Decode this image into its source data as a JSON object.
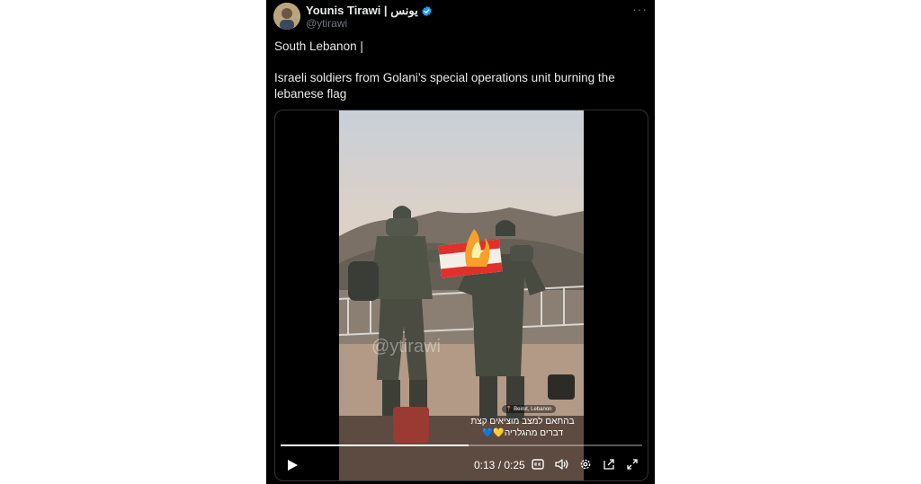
{
  "author": {
    "name": "Younis Tirawi | يونس",
    "handle": "@ytirawi",
    "more_label": "···"
  },
  "post": {
    "line1": "South Lebanon |",
    "line2": "Israeli soldiers from Golani’s special operations unit burning the lebanese flag"
  },
  "video": {
    "watermark": "@ytirawi",
    "location_tag": "Beirut, Lebanon",
    "caption_line1": "בהתאם למצב מוציאים קצת",
    "caption_line2": "דברים מהגלריה💛💙",
    "time": "0:13 / 0:25",
    "progress": 0.52,
    "icons": [
      "play-icon",
      "captions-icon",
      "volume-icon",
      "settings-icon",
      "pip-icon",
      "fullscreen-icon"
    ]
  },
  "colors": {
    "background": "#000000",
    "text": "#e7e9ea",
    "secondary": "#71767b",
    "verified": "#1d9bf0"
  }
}
